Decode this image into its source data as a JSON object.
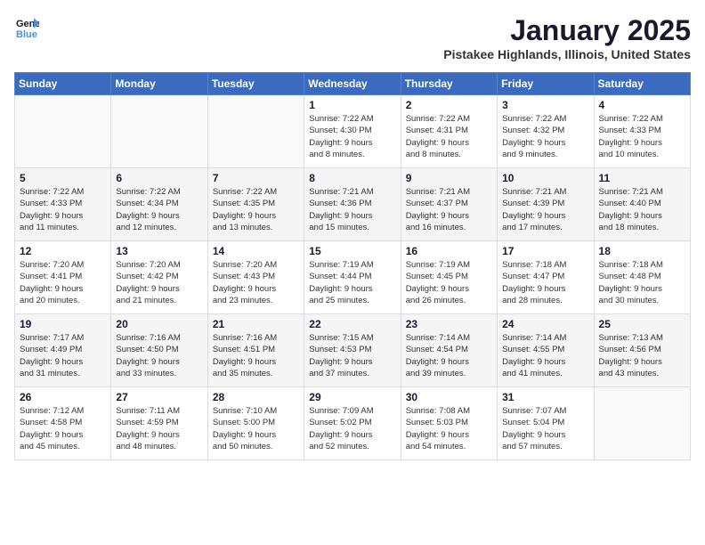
{
  "logo": {
    "line1": "General",
    "line2": "Blue"
  },
  "title": "January 2025",
  "location": "Pistakee Highlands, Illinois, United States",
  "weekdays": [
    "Sunday",
    "Monday",
    "Tuesday",
    "Wednesday",
    "Thursday",
    "Friday",
    "Saturday"
  ],
  "weeks": [
    [
      {
        "day": "",
        "info": ""
      },
      {
        "day": "",
        "info": ""
      },
      {
        "day": "",
        "info": ""
      },
      {
        "day": "1",
        "info": "Sunrise: 7:22 AM\nSunset: 4:30 PM\nDaylight: 9 hours\nand 8 minutes."
      },
      {
        "day": "2",
        "info": "Sunrise: 7:22 AM\nSunset: 4:31 PM\nDaylight: 9 hours\nand 8 minutes."
      },
      {
        "day": "3",
        "info": "Sunrise: 7:22 AM\nSunset: 4:32 PM\nDaylight: 9 hours\nand 9 minutes."
      },
      {
        "day": "4",
        "info": "Sunrise: 7:22 AM\nSunset: 4:33 PM\nDaylight: 9 hours\nand 10 minutes."
      }
    ],
    [
      {
        "day": "5",
        "info": "Sunrise: 7:22 AM\nSunset: 4:33 PM\nDaylight: 9 hours\nand 11 minutes."
      },
      {
        "day": "6",
        "info": "Sunrise: 7:22 AM\nSunset: 4:34 PM\nDaylight: 9 hours\nand 12 minutes."
      },
      {
        "day": "7",
        "info": "Sunrise: 7:22 AM\nSunset: 4:35 PM\nDaylight: 9 hours\nand 13 minutes."
      },
      {
        "day": "8",
        "info": "Sunrise: 7:21 AM\nSunset: 4:36 PM\nDaylight: 9 hours\nand 15 minutes."
      },
      {
        "day": "9",
        "info": "Sunrise: 7:21 AM\nSunset: 4:37 PM\nDaylight: 9 hours\nand 16 minutes."
      },
      {
        "day": "10",
        "info": "Sunrise: 7:21 AM\nSunset: 4:39 PM\nDaylight: 9 hours\nand 17 minutes."
      },
      {
        "day": "11",
        "info": "Sunrise: 7:21 AM\nSunset: 4:40 PM\nDaylight: 9 hours\nand 18 minutes."
      }
    ],
    [
      {
        "day": "12",
        "info": "Sunrise: 7:20 AM\nSunset: 4:41 PM\nDaylight: 9 hours\nand 20 minutes."
      },
      {
        "day": "13",
        "info": "Sunrise: 7:20 AM\nSunset: 4:42 PM\nDaylight: 9 hours\nand 21 minutes."
      },
      {
        "day": "14",
        "info": "Sunrise: 7:20 AM\nSunset: 4:43 PM\nDaylight: 9 hours\nand 23 minutes."
      },
      {
        "day": "15",
        "info": "Sunrise: 7:19 AM\nSunset: 4:44 PM\nDaylight: 9 hours\nand 25 minutes."
      },
      {
        "day": "16",
        "info": "Sunrise: 7:19 AM\nSunset: 4:45 PM\nDaylight: 9 hours\nand 26 minutes."
      },
      {
        "day": "17",
        "info": "Sunrise: 7:18 AM\nSunset: 4:47 PM\nDaylight: 9 hours\nand 28 minutes."
      },
      {
        "day": "18",
        "info": "Sunrise: 7:18 AM\nSunset: 4:48 PM\nDaylight: 9 hours\nand 30 minutes."
      }
    ],
    [
      {
        "day": "19",
        "info": "Sunrise: 7:17 AM\nSunset: 4:49 PM\nDaylight: 9 hours\nand 31 minutes."
      },
      {
        "day": "20",
        "info": "Sunrise: 7:16 AM\nSunset: 4:50 PM\nDaylight: 9 hours\nand 33 minutes."
      },
      {
        "day": "21",
        "info": "Sunrise: 7:16 AM\nSunset: 4:51 PM\nDaylight: 9 hours\nand 35 minutes."
      },
      {
        "day": "22",
        "info": "Sunrise: 7:15 AM\nSunset: 4:53 PM\nDaylight: 9 hours\nand 37 minutes."
      },
      {
        "day": "23",
        "info": "Sunrise: 7:14 AM\nSunset: 4:54 PM\nDaylight: 9 hours\nand 39 minutes."
      },
      {
        "day": "24",
        "info": "Sunrise: 7:14 AM\nSunset: 4:55 PM\nDaylight: 9 hours\nand 41 minutes."
      },
      {
        "day": "25",
        "info": "Sunrise: 7:13 AM\nSunset: 4:56 PM\nDaylight: 9 hours\nand 43 minutes."
      }
    ],
    [
      {
        "day": "26",
        "info": "Sunrise: 7:12 AM\nSunset: 4:58 PM\nDaylight: 9 hours\nand 45 minutes."
      },
      {
        "day": "27",
        "info": "Sunrise: 7:11 AM\nSunset: 4:59 PM\nDaylight: 9 hours\nand 48 minutes."
      },
      {
        "day": "28",
        "info": "Sunrise: 7:10 AM\nSunset: 5:00 PM\nDaylight: 9 hours\nand 50 minutes."
      },
      {
        "day": "29",
        "info": "Sunrise: 7:09 AM\nSunset: 5:02 PM\nDaylight: 9 hours\nand 52 minutes."
      },
      {
        "day": "30",
        "info": "Sunrise: 7:08 AM\nSunset: 5:03 PM\nDaylight: 9 hours\nand 54 minutes."
      },
      {
        "day": "31",
        "info": "Sunrise: 7:07 AM\nSunset: 5:04 PM\nDaylight: 9 hours\nand 57 minutes."
      },
      {
        "day": "",
        "info": ""
      }
    ]
  ]
}
